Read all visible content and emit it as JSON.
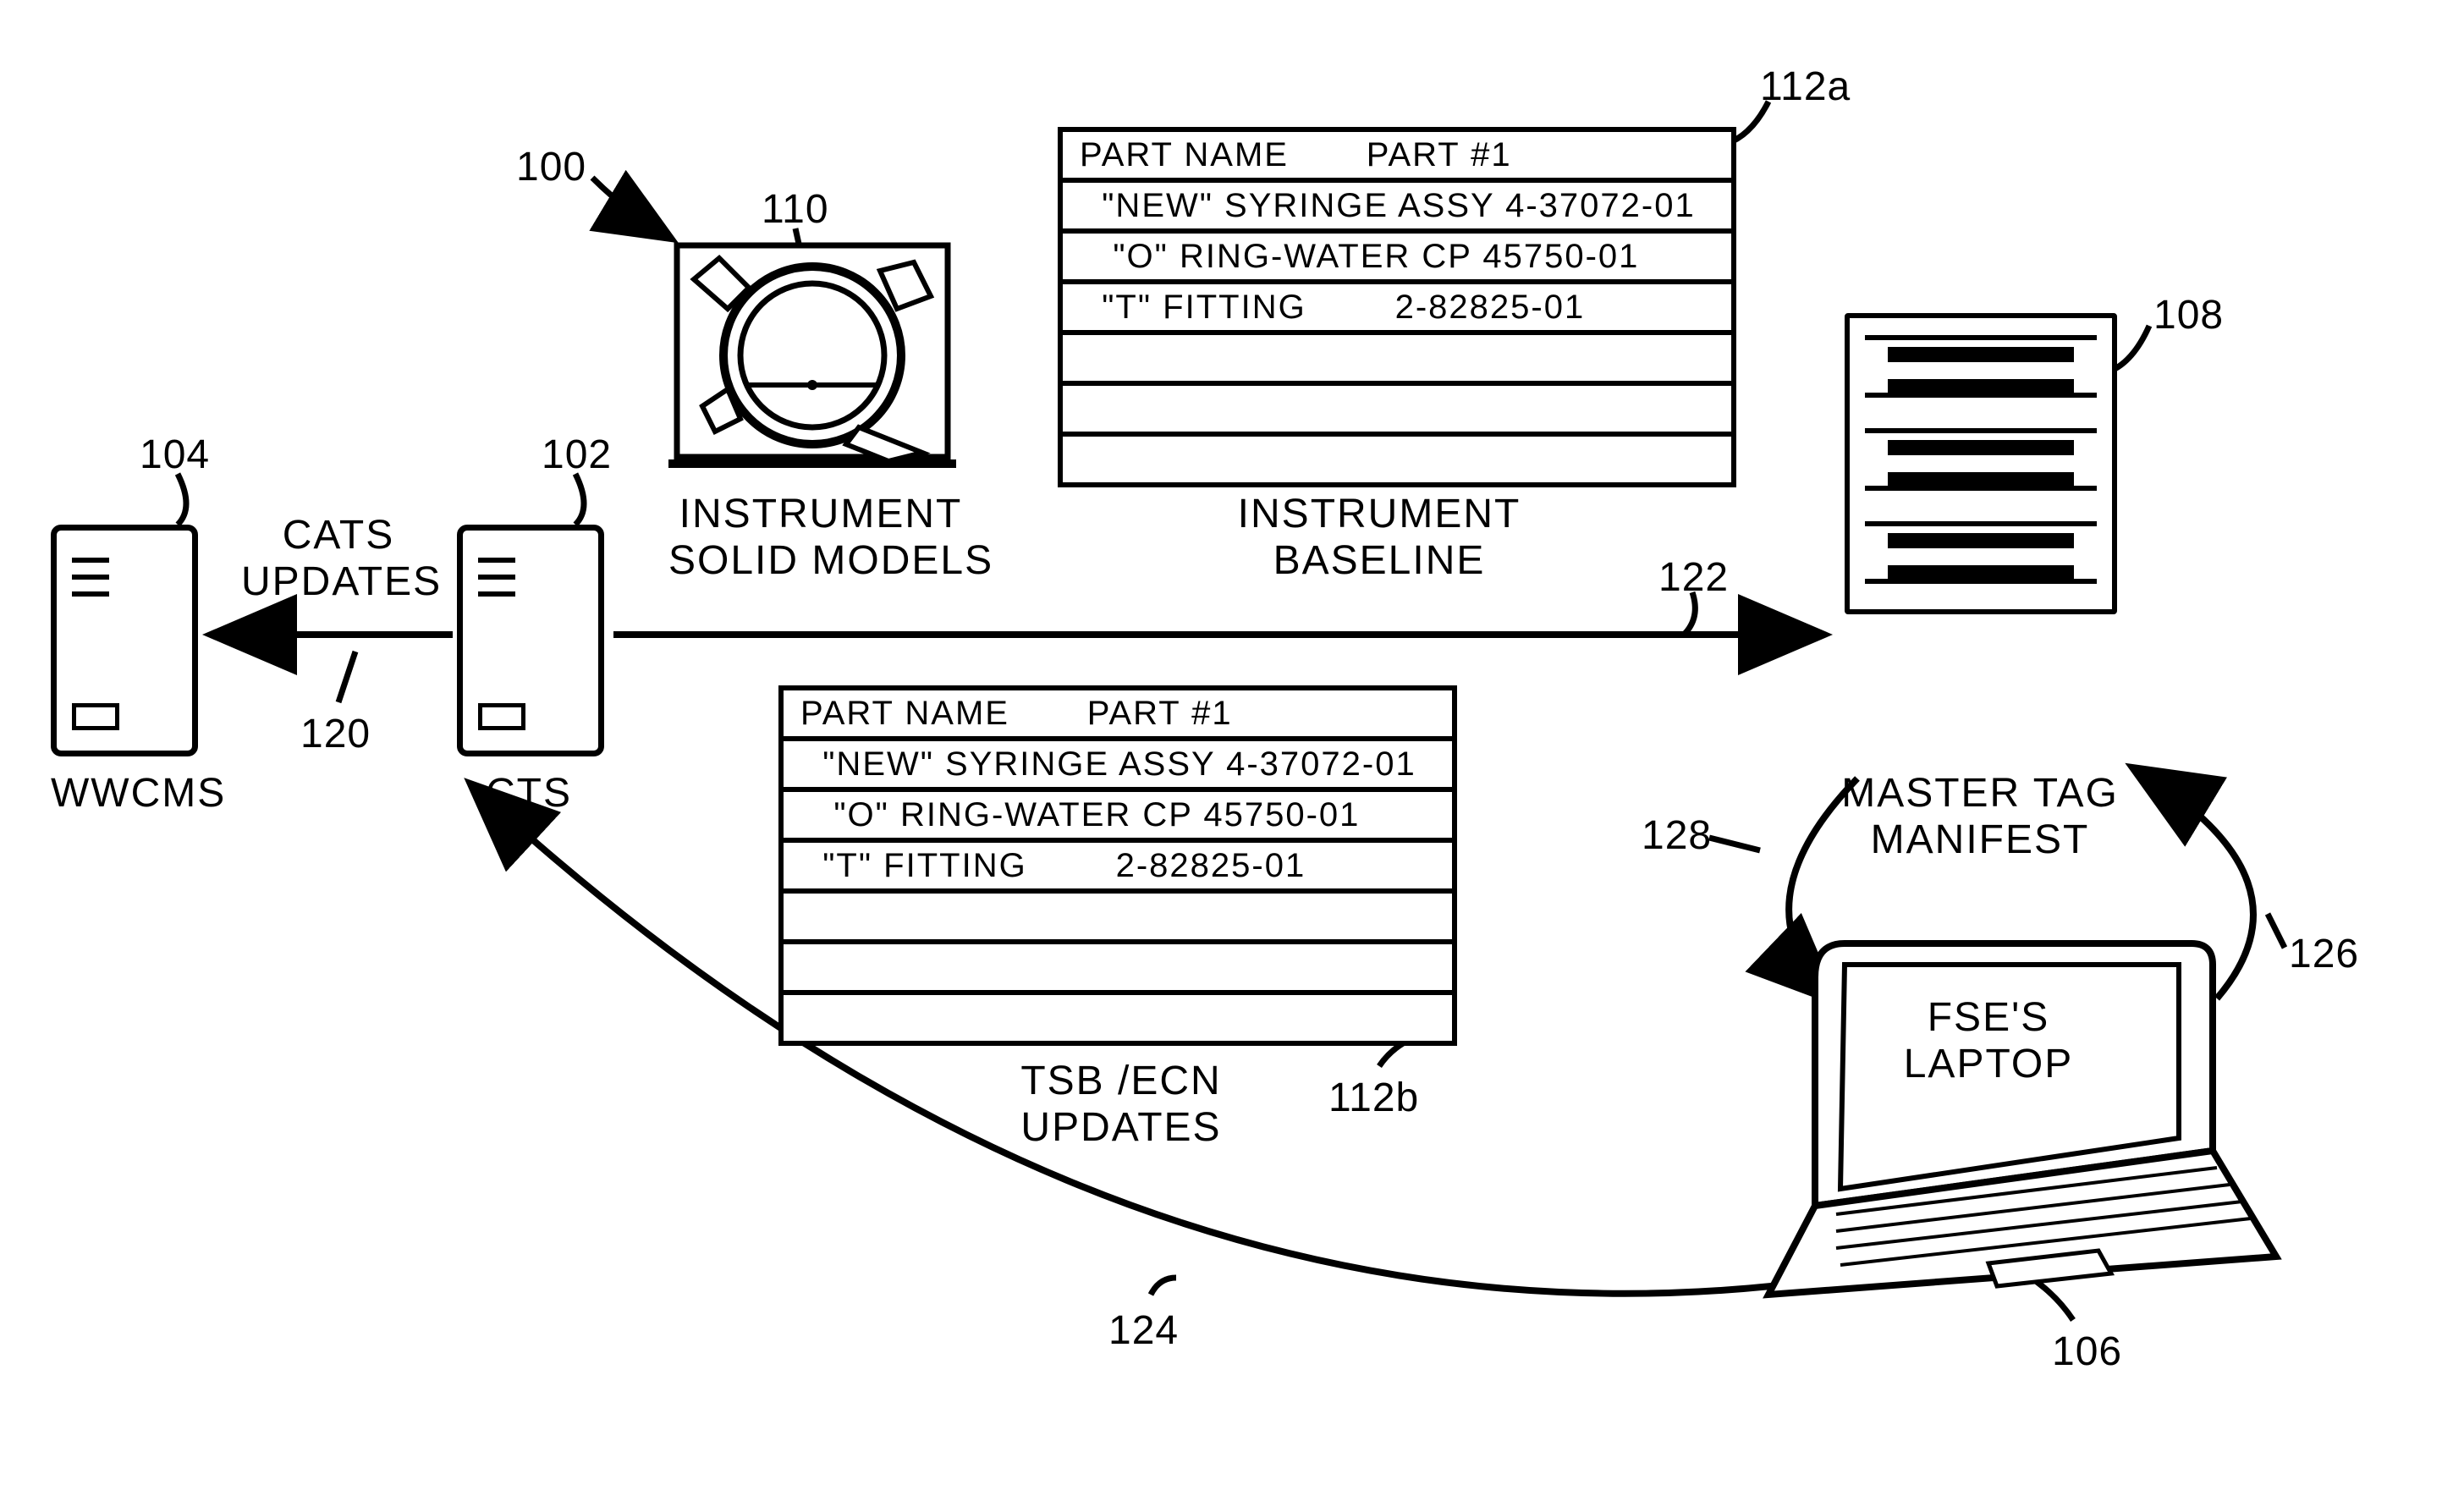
{
  "labels": {
    "wwcms": "WWCMS",
    "cts": "CTS",
    "cats_updates": "CATS\nUPDATES",
    "instrument_solid_models": "INSTRUMENT\nSOLID MODELS",
    "instrument_baseline": "INSTRUMENT\nBASELINE",
    "tsb_ecn_updates": "TSB /ECN\nUPDATES",
    "master_tag_manifest": "MASTER TAG\nMANIFEST",
    "fse_laptop": "FSE'S\nLAPTOP"
  },
  "refs": {
    "r100": "100",
    "r102": "102",
    "r104": "104",
    "r106": "106",
    "r108": "108",
    "r110": "110",
    "r112a": "112a",
    "r112b": "112b",
    "r120": "120",
    "r122": "122",
    "r124": "124",
    "r126": "126",
    "r128": "128"
  },
  "table_header": "PART NAME       PART #1",
  "table_rows": [
    "  \"NEW\" SYRINGE ASSY 4-37072-01",
    "   \"O\" RING-WATER CP 45750-01",
    "  \"T\" FITTING        2-82825-01",
    "",
    "",
    ""
  ]
}
